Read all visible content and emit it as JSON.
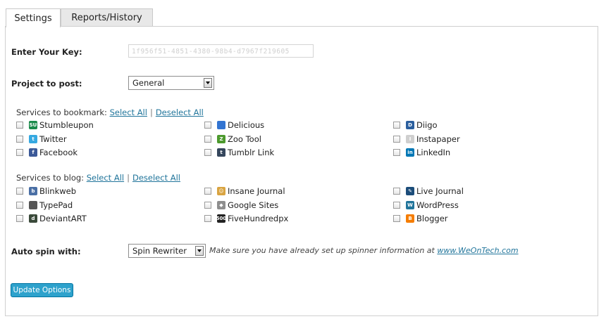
{
  "tabs": [
    {
      "label": "Settings",
      "active": true
    },
    {
      "label": "Reports/History",
      "active": false
    }
  ],
  "key": {
    "label": "Enter Your Key:",
    "value": "1f956f51-4851-4380-98b4-d7967f219605"
  },
  "project": {
    "label": "Project to post:",
    "selected": "General"
  },
  "bookmark": {
    "title": "Services to bookmark:",
    "select_all": "Select All",
    "separator": "|",
    "deselect_all": "Deselect All",
    "services": [
      {
        "name": "Stumbleupon",
        "icon": "stumbleupon-icon",
        "glyph": "SU",
        "color": "#1a8a4a"
      },
      {
        "name": "Delicious",
        "icon": "delicious-icon",
        "glyph": "",
        "color": "#3274d1"
      },
      {
        "name": "Diigo",
        "icon": "diigo-icon",
        "glyph": "D",
        "color": "#2b5f9e"
      },
      {
        "name": "Twitter",
        "icon": "twitter-icon",
        "glyph": "t",
        "color": "#36a9e1"
      },
      {
        "name": "Zoo Tool",
        "icon": "zootool-icon",
        "glyph": "Z",
        "color": "#4d9a2e"
      },
      {
        "name": "Instapaper",
        "icon": "instapaper-icon",
        "glyph": "I",
        "color": "#cfcfcf"
      },
      {
        "name": "Facebook",
        "icon": "facebook-icon",
        "glyph": "f",
        "color": "#3b5998"
      },
      {
        "name": "Tumblr Link",
        "icon": "tumblr-icon",
        "glyph": "t",
        "color": "#35465c"
      },
      {
        "name": "LinkedIn",
        "icon": "linkedin-icon",
        "glyph": "in",
        "color": "#0077b5"
      }
    ]
  },
  "blog": {
    "title": "Services to blog:",
    "select_all": "Select All",
    "separator": "|",
    "deselect_all": "Deselect All",
    "services": [
      {
        "name": "Blinkweb",
        "icon": "blinkweb-icon",
        "glyph": "b",
        "color": "#4a6fa5"
      },
      {
        "name": "Insane Journal",
        "icon": "insanejournal-icon",
        "glyph": "☺",
        "color": "#d9a441"
      },
      {
        "name": "Live Journal",
        "icon": "livejournal-icon",
        "glyph": "✎",
        "color": "#1c4d7a"
      },
      {
        "name": "TypePad",
        "icon": "typepad-icon",
        "glyph": "",
        "color": "#555555"
      },
      {
        "name": "Google Sites",
        "icon": "googlesites-icon",
        "glyph": "◆",
        "color": "#8e8e8e"
      },
      {
        "name": "WordPress",
        "icon": "wordpress-icon",
        "glyph": "W",
        "color": "#21759b"
      },
      {
        "name": "DeviantART",
        "icon": "deviantart-icon",
        "glyph": "d",
        "color": "#3a4a3a"
      },
      {
        "name": "FiveHundredpx",
        "icon": "500px-icon",
        "glyph": "500",
        "color": "#222222"
      },
      {
        "name": "Blogger",
        "icon": "blogger-icon",
        "glyph": "B",
        "color": "#f57d00"
      }
    ]
  },
  "spin": {
    "label": "Auto spin with:",
    "selected": "Spin Rewriter",
    "note": "Make sure you have already set up spinner information at ",
    "link": "www.WeOnTech.com"
  },
  "submit_label": "Update Options"
}
